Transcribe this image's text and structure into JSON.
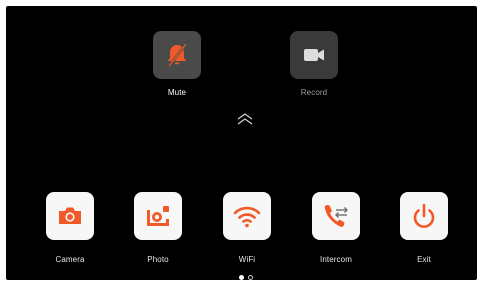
{
  "top_controls": [
    {
      "id": "mute",
      "label": "Mute",
      "icon": "bell-muted-icon",
      "bg": "#4a4a4a",
      "icon_color": "#f05a28",
      "label_color": "#ffffff"
    },
    {
      "id": "record",
      "label": "Record",
      "icon": "video-camera-icon",
      "bg": "#3a3a3a",
      "icon_color": "#dcdcdc",
      "label_color": "#9a9a9a"
    }
  ],
  "expand_icon": "chevron-double-up-icon",
  "apps": [
    {
      "id": "camera",
      "label": "Camera",
      "icon": "camera-icon"
    },
    {
      "id": "photo",
      "label": "Photo",
      "icon": "photo-icon"
    },
    {
      "id": "wifi",
      "label": "WiFi",
      "icon": "wifi-icon"
    },
    {
      "id": "intercom",
      "label": "Intercom",
      "icon": "intercom-phone-icon"
    },
    {
      "id": "exit",
      "label": "Exit",
      "icon": "power-icon"
    }
  ],
  "pagination": {
    "total": 2,
    "active": 1
  },
  "colors": {
    "accent": "#f05a28",
    "screen_bg": "#000000",
    "app_tile_bg": "#f7f7f7",
    "label_text": "#e6e6e6"
  }
}
